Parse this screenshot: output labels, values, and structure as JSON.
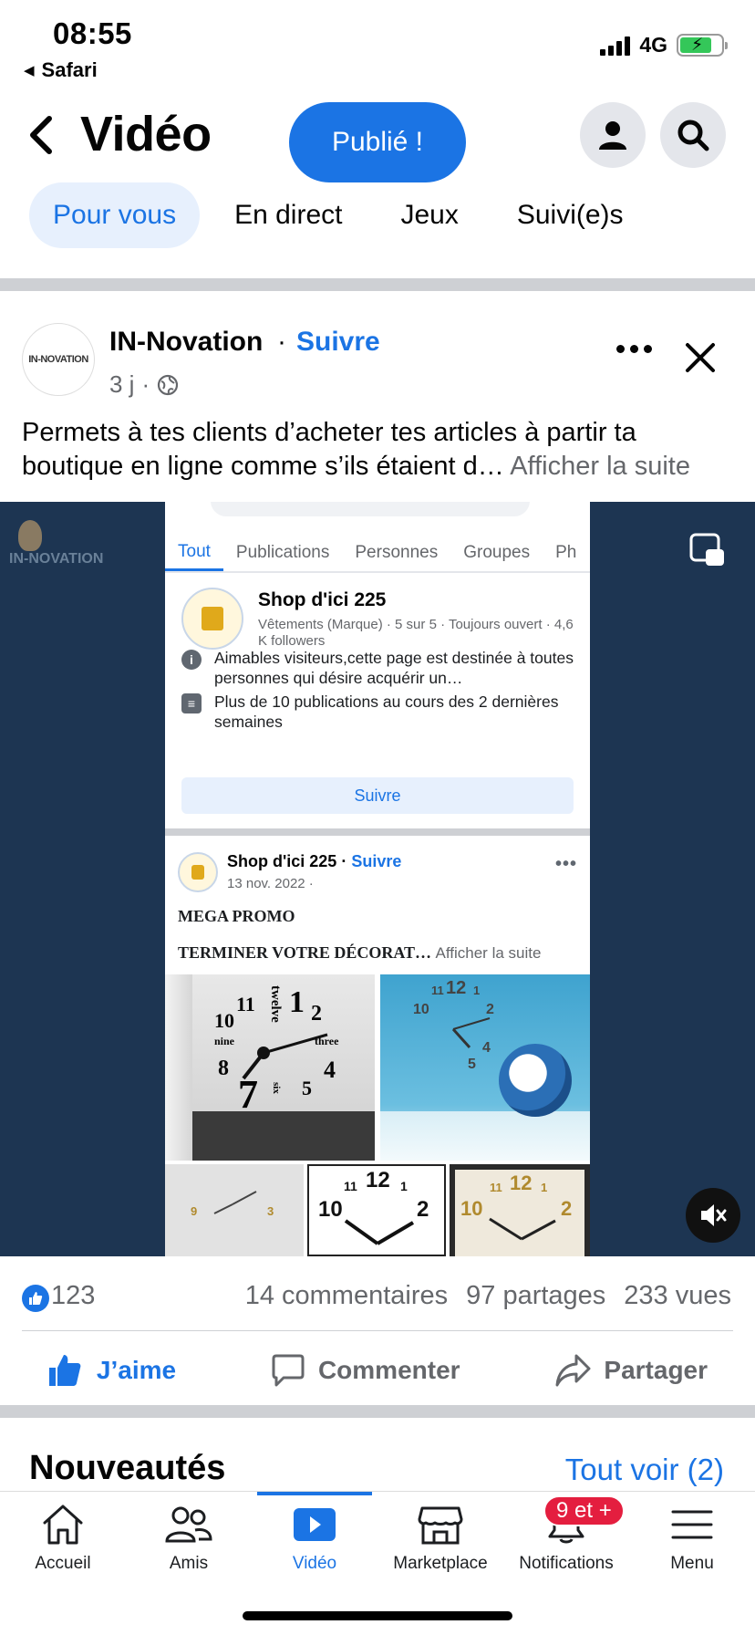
{
  "status_bar": {
    "time": "08:55",
    "back_app": "Safari",
    "network": "4G"
  },
  "header": {
    "title": "Vidéo",
    "publish_button": "Publié !",
    "icons": [
      "back-chevron-icon",
      "profile-icon",
      "search-icon"
    ]
  },
  "tabs": [
    {
      "label": "Pour vous",
      "active": true
    },
    {
      "label": "En direct",
      "active": false
    },
    {
      "label": "Jeux",
      "active": false
    },
    {
      "label": "Suivi(e)s",
      "active": false
    }
  ],
  "post": {
    "author": "IN-Novation",
    "dot": "·",
    "follow": "Suivre",
    "time_ago": "3 j",
    "meta_dot": "·",
    "avatar_text": "IN-NOVATION",
    "caption": "Permets à tes clients d’acheter tes articles à partir ta boutique en ligne comme s’ils étaient d…",
    "see_more": "Afficher la suite"
  },
  "video": {
    "watermark": "IN-NOVATION",
    "inner": {
      "tabs": [
        "Tout",
        "Publications",
        "Personnes",
        "Groupes",
        "Ph"
      ],
      "page_name": "Shop d'ici 225",
      "page_meta": "Vêtements (Marque) · 5 sur 5 · Toujours ouvert · 4,6 K followers",
      "info_1": "Aimables visiteurs,cette page est destinée à toutes personnes qui désire acquérir un…",
      "info_2": "Plus de 10 publications au cours des 2 dernières semaines",
      "follow_button": "Suivre",
      "post_author": "Shop d'ici 225",
      "post_follow": "Suivre",
      "post_date": "13 nov. 2022 ·",
      "post_line1": "MEGA PROMO",
      "post_line2": "TERMINER VOTRE DÉCORAT…",
      "post_see_more": "Afficher la suite",
      "clock1_numbers": [
        "11",
        "twelve",
        "1",
        "2",
        "10",
        "nine",
        "three",
        "8",
        "4",
        "7",
        "six",
        "5"
      ],
      "clock2_numbers": [
        "11",
        "12",
        "1",
        "2",
        "10",
        "4",
        "5"
      ],
      "thumb_numbers": [
        "9",
        "3",
        "12",
        "11",
        "1",
        "10",
        "2",
        "12",
        "11",
        "1",
        "10",
        "2"
      ]
    }
  },
  "reactions": {
    "likes": "123",
    "comments": "14 commentaires",
    "shares": "97 partages",
    "views": "233 vues"
  },
  "actions": {
    "like": "J’aime",
    "comment": "Commenter",
    "share": "Partager"
  },
  "nouveautes": {
    "title": "Nouveautés",
    "see_all": "Tout voir (2)"
  },
  "bottom_nav": [
    {
      "label": "Accueil",
      "icon": "home-icon",
      "active": false
    },
    {
      "label": "Amis",
      "icon": "friends-icon",
      "active": false
    },
    {
      "label": "Vidéo",
      "icon": "video-icon",
      "active": true
    },
    {
      "label": "Marketplace",
      "icon": "marketplace-icon",
      "active": false
    },
    {
      "label": "Notifications",
      "icon": "bell-icon",
      "active": false,
      "badge": "9 et +"
    },
    {
      "label": "Menu",
      "icon": "menu-icon",
      "active": false
    }
  ],
  "colors": {
    "accent": "#1b74e4",
    "badge": "#e41e3f",
    "video_bg": "#1d3552"
  }
}
